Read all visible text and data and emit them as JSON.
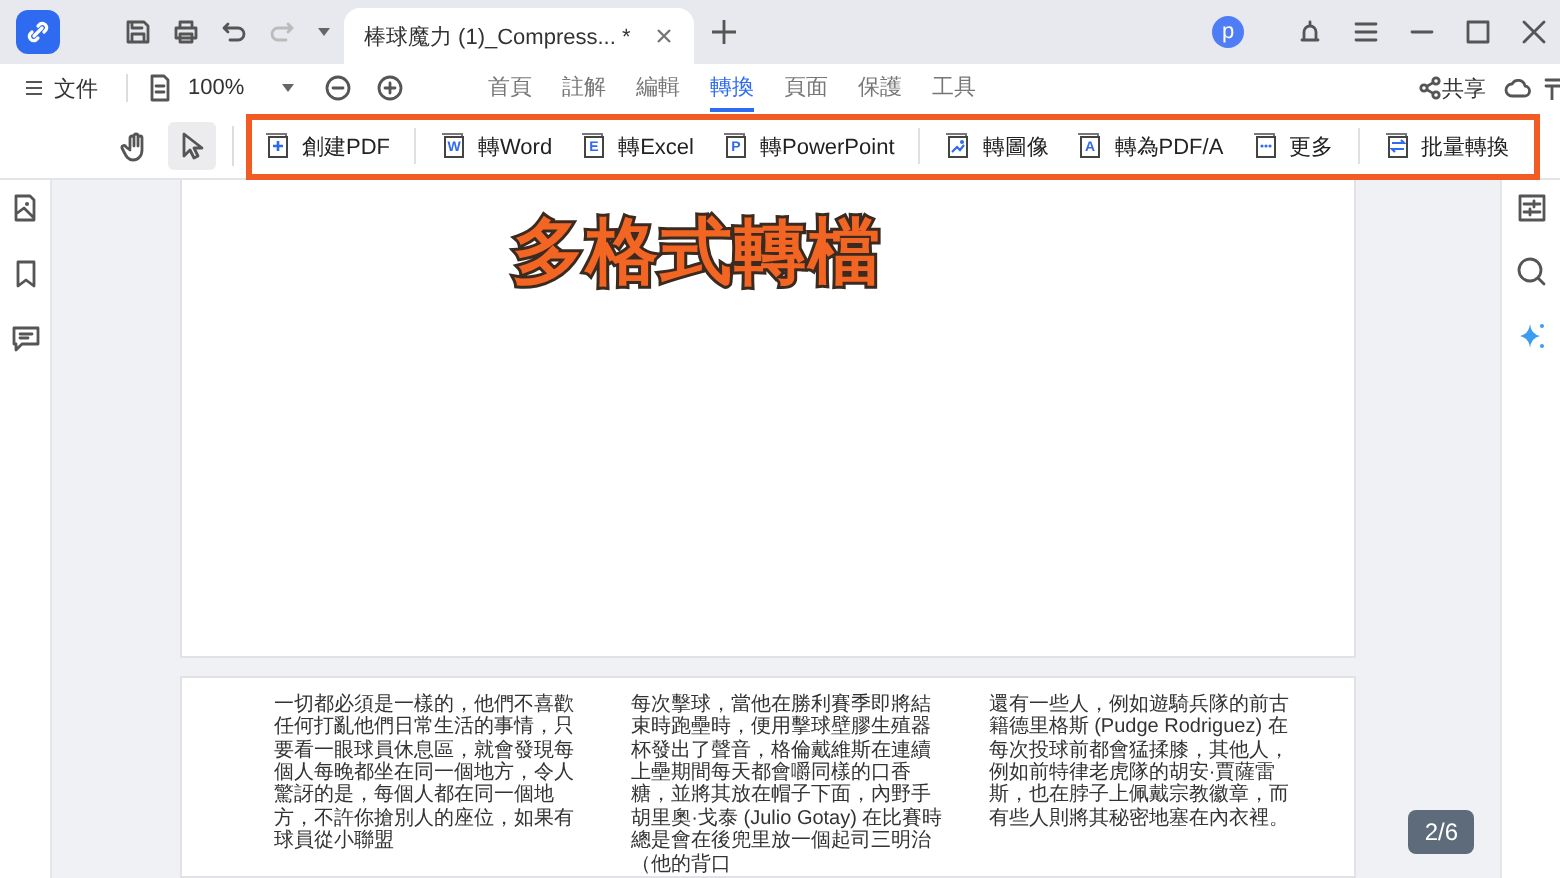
{
  "title_bar": {
    "tab_title": "棒球魔力 (1)_Compress... *",
    "avatar": "p"
  },
  "menu_bar": {
    "file": "文件",
    "zoom": "100%",
    "share": "共享",
    "tabs": [
      {
        "label": "首頁",
        "selected": false
      },
      {
        "label": "註解",
        "selected": false
      },
      {
        "label": "編輯",
        "selected": false
      },
      {
        "label": "轉換",
        "selected": true
      },
      {
        "label": "頁面",
        "selected": false
      },
      {
        "label": "保護",
        "selected": false
      },
      {
        "label": "工具",
        "selected": false
      }
    ]
  },
  "toolbar": {
    "tools": [
      {
        "kind": "hand",
        "selected": false
      },
      {
        "kind": "pointer",
        "selected": true
      }
    ],
    "groups": [
      [
        {
          "label": "創建PDF",
          "kind": "plus"
        }
      ],
      [
        {
          "label": "轉Word",
          "kind": "W"
        },
        {
          "label": "轉Excel",
          "kind": "E"
        },
        {
          "label": "轉PowerPoint",
          "kind": "P"
        }
      ],
      [
        {
          "label": "轉圖像",
          "kind": "image"
        },
        {
          "label": "轉為PDF/A",
          "kind": "A"
        },
        {
          "label": "更多",
          "kind": "dots"
        }
      ],
      [
        {
          "label": "批量轉換",
          "kind": "swap"
        }
      ]
    ]
  },
  "annotation": "多格式轉檔",
  "document": {
    "columns": [
      "一切都必須是一樣的，他們不喜歡任何打亂他們日常生活的事情，只要看一眼球員休息區，就會發現每個人每晚都坐在同一個地方，令人驚訝的是，每個人都在同一個地方，不許你搶別人的座位，如果有球員從小聯盟",
      "每次擊球，當他在勝利賽季即將結束時跑壘時，便用擊球壁膠生殖器杯發出了聲音，格倫戴維斯在連續上壘期間每天都會嚼同樣的口香糖，並將其放在帽子下面，內野手胡里奧·戈泰 (Julio Gotay) 在比賽時總是會在後兜里放一個起司三明治（他的背口",
      "還有一些人，例如遊騎兵隊的前古籍德里格斯 (Pudge Rodriguez) 在每次投球前都會猛揉膝，其他人，例如前特律老虎隊的胡安·賈薩雷斯，也在脖子上佩戴宗教徽章，而有些人則將其秘密地塞在內衣裡。"
    ]
  },
  "page_indicator": "2/6"
}
